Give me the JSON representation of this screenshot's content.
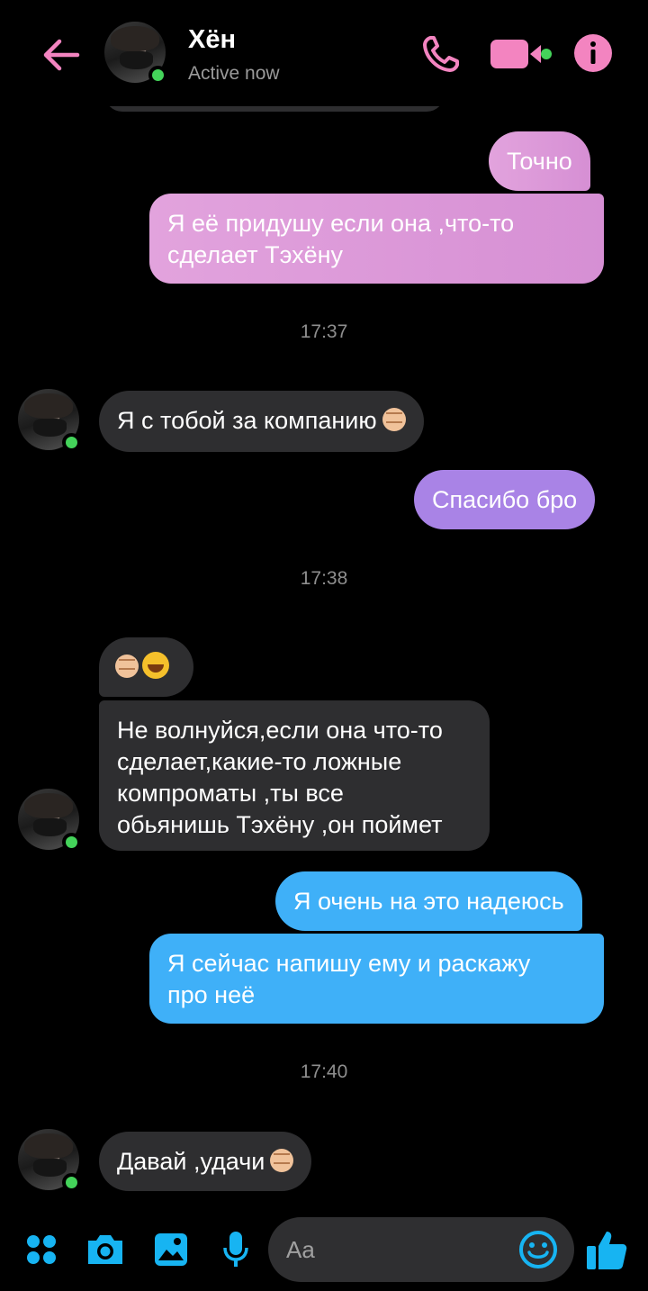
{
  "header": {
    "contact_name": "Хён",
    "status": "Active now"
  },
  "colors": {
    "accent_pink": "#f384c0",
    "accent_blue": "#17b4f2",
    "online_green": "#44d35a"
  },
  "messages": [
    {
      "side": "out",
      "text": "Точно"
    },
    {
      "side": "out",
      "text_lines": [
        "Я её придушу если она ,что-то",
        "сделает Тэхёну"
      ]
    },
    {
      "timestamp": "17:37"
    },
    {
      "side": "in",
      "text": "Я с тобой за компанию"
    },
    {
      "side": "out",
      "text": "Спасибо бро"
    },
    {
      "timestamp": "17:38"
    },
    {
      "side": "in",
      "emoji": "fist laugh"
    },
    {
      "side": "in",
      "text_lines": [
        "Не волнуйся,если она что-то",
        "сделает,какие-то ложные",
        "компроматы ,ты все",
        "обьянишь Тэхёну ,он поймет"
      ]
    },
    {
      "side": "out",
      "text": "Я очень на это надеюсь"
    },
    {
      "side": "out",
      "text_lines": [
        "Я сейчас напишу ему и раскажу",
        "про неё"
      ]
    },
    {
      "timestamp": "17:40"
    },
    {
      "side": "in",
      "text": "Давай ,удачи"
    }
  ],
  "composer": {
    "placeholder": "Aa"
  },
  "icons": [
    "back-arrow-icon",
    "phone-icon",
    "video-camera-icon",
    "info-icon",
    "apps-grid-icon",
    "camera-icon",
    "image-icon",
    "microphone-icon",
    "emoji-icon",
    "thumbs-up-icon"
  ]
}
